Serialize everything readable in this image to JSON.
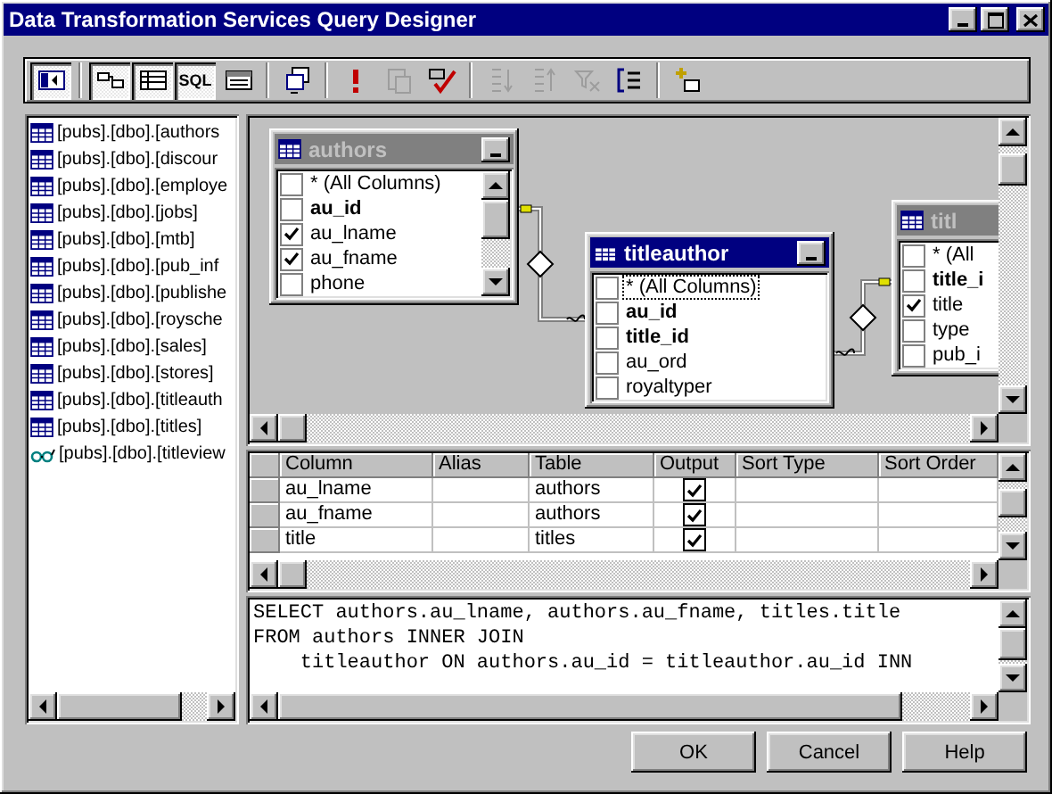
{
  "window": {
    "title": "Data Transformation Services Query Designer"
  },
  "toolbar": {
    "items": [
      {
        "kind": "panel",
        "pressed": true
      },
      {
        "kind": "separator"
      },
      {
        "kind": "diagram",
        "pressed": true
      },
      {
        "kind": "grid",
        "pressed": true
      },
      {
        "kind": "sql",
        "text": "SQL",
        "pressed": true
      },
      {
        "kind": "results",
        "pressed": false
      },
      {
        "kind": "separator"
      },
      {
        "kind": "query-type",
        "disabled": false
      },
      {
        "kind": "separator"
      },
      {
        "kind": "run",
        "disabled": false
      },
      {
        "kind": "paste",
        "disabled": true
      },
      {
        "kind": "verify",
        "disabled": false
      },
      {
        "kind": "separator"
      },
      {
        "kind": "sort-asc",
        "disabled": true
      },
      {
        "kind": "sort-desc",
        "disabled": true
      },
      {
        "kind": "remove-filter",
        "disabled": true
      },
      {
        "kind": "group-by",
        "disabled": false
      },
      {
        "kind": "separator"
      },
      {
        "kind": "add-table",
        "disabled": false
      }
    ]
  },
  "source_tables": [
    {
      "kind": "table",
      "name": "[pubs].[dbo].[authors"
    },
    {
      "kind": "table",
      "name": "[pubs].[dbo].[discour"
    },
    {
      "kind": "table",
      "name": "[pubs].[dbo].[employe"
    },
    {
      "kind": "table",
      "name": "[pubs].[dbo].[jobs]"
    },
    {
      "kind": "table",
      "name": "[pubs].[dbo].[mtb]"
    },
    {
      "kind": "table",
      "name": "[pubs].[dbo].[pub_inf"
    },
    {
      "kind": "table",
      "name": "[pubs].[dbo].[publishe"
    },
    {
      "kind": "table",
      "name": "[pubs].[dbo].[roysche"
    },
    {
      "kind": "table",
      "name": "[pubs].[dbo].[sales]"
    },
    {
      "kind": "table",
      "name": "[pubs].[dbo].[stores]"
    },
    {
      "kind": "table",
      "name": "[pubs].[dbo].[titleauth"
    },
    {
      "kind": "table",
      "name": "[pubs].[dbo].[titles]"
    },
    {
      "kind": "view",
      "name": "[pubs].[dbo].[titleview"
    }
  ],
  "diagram": {
    "tables": [
      {
        "title": "authors",
        "active": false,
        "fields": [
          {
            "name": "* (All Columns)",
            "key": false,
            "checked": false,
            "focused": false
          },
          {
            "name": "au_id",
            "key": true,
            "checked": false,
            "focused": false
          },
          {
            "name": "au_lname",
            "key": false,
            "checked": true,
            "focused": false
          },
          {
            "name": "au_fname",
            "key": false,
            "checked": true,
            "focused": false
          },
          {
            "name": "phone",
            "key": false,
            "checked": false,
            "focused": false
          }
        ]
      },
      {
        "title": "titleauthor",
        "active": true,
        "fields": [
          {
            "name": "* (All Columns)",
            "key": false,
            "checked": false,
            "focused": true
          },
          {
            "name": "au_id",
            "key": true,
            "checked": false,
            "focused": false
          },
          {
            "name": "title_id",
            "key": true,
            "checked": false,
            "focused": false
          },
          {
            "name": "au_ord",
            "key": false,
            "checked": false,
            "focused": false
          },
          {
            "name": "royaltyper",
            "key": false,
            "checked": false,
            "focused": false
          }
        ]
      },
      {
        "title": "titl",
        "active": false,
        "fields": [
          {
            "name": "* (All",
            "key": false,
            "checked": false,
            "focused": false
          },
          {
            "name": "title_i",
            "key": true,
            "checked": false,
            "focused": false
          },
          {
            "name": "title",
            "key": false,
            "checked": true,
            "focused": false
          },
          {
            "name": "type",
            "key": false,
            "checked": false,
            "focused": false
          },
          {
            "name": "pub_i",
            "key": false,
            "checked": false,
            "focused": false
          }
        ]
      }
    ]
  },
  "grid": {
    "columns": [
      "Column",
      "Alias",
      "Table",
      "Output",
      "Sort Type",
      "Sort Order"
    ],
    "rows": [
      {
        "column": "au_lname",
        "table": "authors",
        "output": true
      },
      {
        "column": "au_fname",
        "table": "authors",
        "output": true
      },
      {
        "column": "title",
        "table": "titles",
        "output": true
      }
    ]
  },
  "sql": {
    "lines": [
      "SELECT authors.au_lname, authors.au_fname, titles.title",
      "FROM authors INNER JOIN",
      "    titleauthor ON authors.au_id = titleauthor.au_id INN"
    ]
  },
  "buttons": [
    "OK",
    "Cancel",
    "Help"
  ]
}
